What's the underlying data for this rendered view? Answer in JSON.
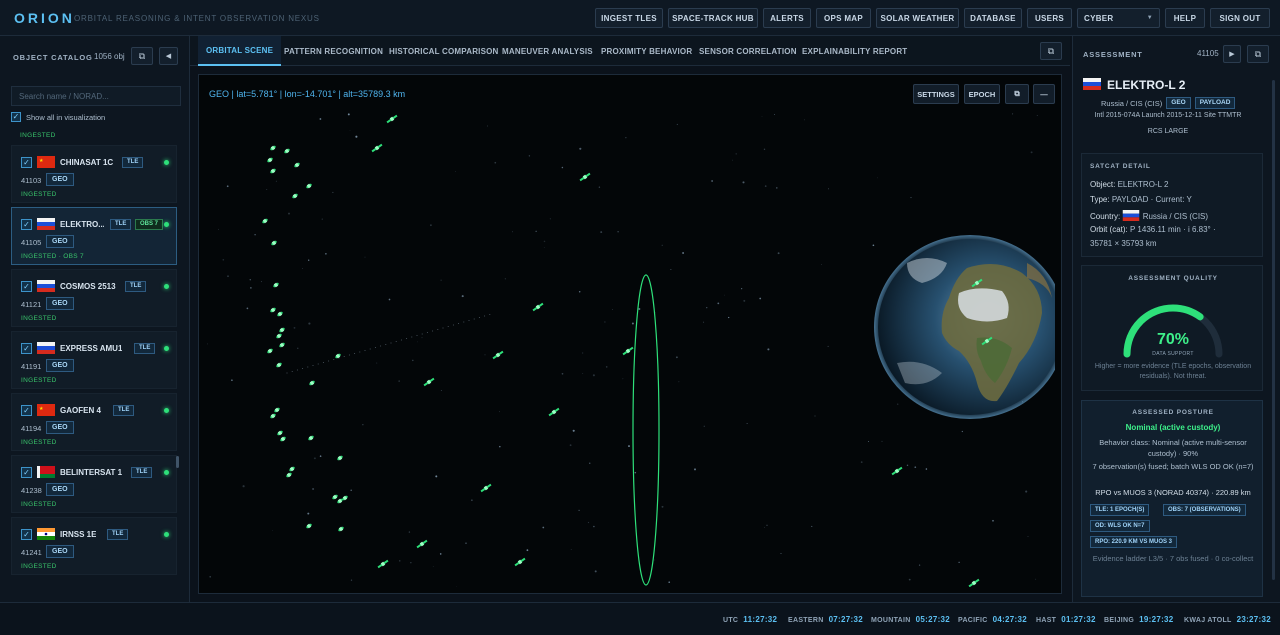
{
  "app": {
    "brand": "ORION",
    "subtitle": "ORBITAL REASONING & INTENT OBSERVATION NEXUS"
  },
  "topnav": {
    "buttons": [
      "INGEST TLES",
      "SPACE-TRACK HUB",
      "ALERTS",
      "OPS MAP",
      "SOLAR WEATHER",
      "DATABASE",
      "USERS"
    ],
    "theme_select": "CYBER",
    "help": "HELP",
    "signout": "SIGN OUT"
  },
  "catalog": {
    "title": "OBJECT CATALOG",
    "count": "1056 obj",
    "search_placeholder": "Search name / NORAD...",
    "show_all_label": "Show all in visualization",
    "top_stub_status": "INGESTED",
    "items": [
      {
        "name": "CHINASAT 1C",
        "tle": "TLE",
        "obs": "",
        "norad": "41103",
        "orbit": "GEO",
        "status": "INGESTED",
        "flag": "cn",
        "selected": false
      },
      {
        "name": "ELEKTRO...",
        "tle": "TLE",
        "obs": "OBS 7",
        "norad": "41105",
        "orbit": "GEO",
        "status": "INGESTED · OBS 7",
        "flag": "ru",
        "selected": true
      },
      {
        "name": "COSMOS 2513",
        "tle": "TLE",
        "obs": "",
        "norad": "41121",
        "orbit": "GEO",
        "status": "INGESTED",
        "flag": "ru",
        "selected": false
      },
      {
        "name": "EXPRESS AMU1",
        "tle": "TLE",
        "obs": "",
        "norad": "41191",
        "orbit": "GEO",
        "status": "INGESTED",
        "flag": "ru",
        "selected": false
      },
      {
        "name": "GAOFEN 4",
        "tle": "TLE",
        "obs": "",
        "norad": "41194",
        "orbit": "GEO",
        "status": "INGESTED",
        "flag": "cn",
        "selected": false
      },
      {
        "name": "BELINTERSAT 1",
        "tle": "TLE",
        "obs": "",
        "norad": "41238",
        "orbit": "GEO",
        "status": "INGESTED",
        "flag": "by",
        "selected": false
      },
      {
        "name": "IRNSS 1E",
        "tle": "TLE",
        "obs": "",
        "norad": "41241",
        "orbit": "GEO",
        "status": "INGESTED",
        "flag": "in",
        "selected": false
      }
    ]
  },
  "tabs": [
    "ORBITAL SCENE",
    "PATTERN RECOGNITION",
    "HISTORICAL COMPARISON",
    "MANEUVER ANALYSIS",
    "PROXIMITY BEHAVIOR",
    "SENSOR CORRELATION",
    "EXPLAINABILITY REPORT"
  ],
  "scene": {
    "coords": "GEO | lat=5.781° | lon=-14.701° | alt=35789.3 km",
    "settings": "SETTINGS",
    "epoch": "EPOCH",
    "minimize": "—"
  },
  "assessment": {
    "title": "ASSESSMENT",
    "norad": "41105",
    "object_name": "ELEKTRO-L 2",
    "country": "Russia / CIS (CIS)",
    "orbit_pill": "GEO",
    "type_pill": "PAYLOAD",
    "intl_line": "Intl 2015-074A  Launch 2015-12-11  Site TTMTR",
    "rcs": "RCS LARGE",
    "satcat": {
      "title": "SATCAT DETAIL",
      "object_label": "Object:",
      "object_value": "ELEKTRO-L 2",
      "type_label": "Type:",
      "type_value": "PAYLOAD · Current: Y",
      "country_label": "Country:",
      "country_value": "Russia / CIS (CIS)",
      "orbit_label": "Orbit (cat):",
      "orbit_value": "P 1436.11 min · i 6.83° ·",
      "orbit_value2": "35781 × 35793 km"
    },
    "quality": {
      "title": "ASSESSMENT QUALITY",
      "value": "70%",
      "fraction": 0.7,
      "sub": "DATA SUPPORT",
      "note": "Higher = more evidence (TLE epochs, observation residuals). Not threat."
    },
    "posture": {
      "title": "ASSESSED POSTURE",
      "value": "Nominal (active custody)",
      "behavior": "Behavior class: Nominal (active multi-sensor custody) · 90%",
      "fused": "7 observation(s) fused; batch WLS OD OK (n=7)",
      "rpo": "RPO vs MUOS 3 (NORAD 40374) · 220.89 km",
      "tags": [
        "TLE: 1 EPOCH(S)",
        "OBS: 7 (OBSERVATIONS)",
        "OD: WLS OK N=7",
        "RPO: 220.9 KM VS MUOS 3"
      ],
      "ladder": "Evidence ladder L3/5 · 7 obs fused · 0 co-collect"
    }
  },
  "clocks": [
    {
      "label": "UTC",
      "time": "11:27:32"
    },
    {
      "label": "EASTERN",
      "time": "07:27:32"
    },
    {
      "label": "MOUNTAIN",
      "time": "05:27:32"
    },
    {
      "label": "PACIFIC",
      "time": "04:27:32"
    },
    {
      "label": "HAST",
      "time": "01:27:32"
    },
    {
      "label": "BEIJING",
      "time": "19:27:32"
    },
    {
      "label": "KWAJ ATOLL",
      "time": "23:27:32"
    }
  ],
  "colors": {
    "accent": "#5cc0f2",
    "ok": "#3df08a",
    "sat": "#2ee07a"
  }
}
